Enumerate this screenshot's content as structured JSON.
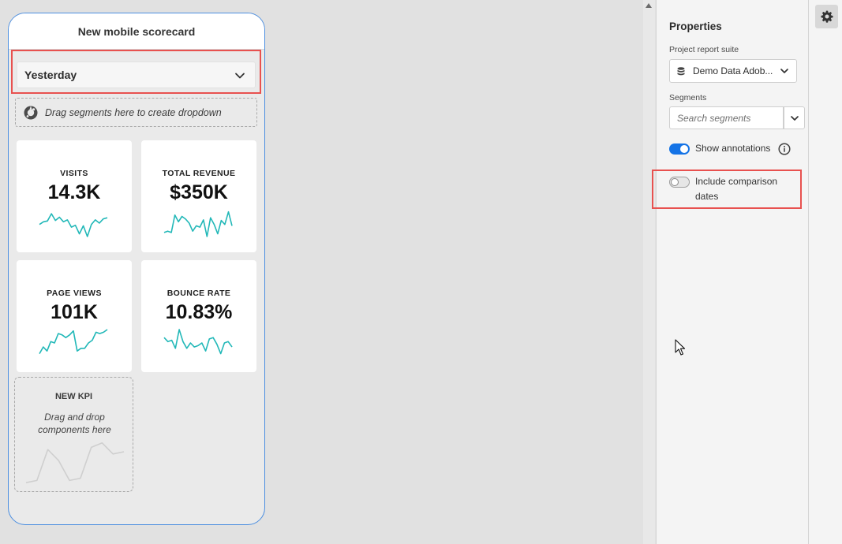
{
  "scorecard": {
    "title": "New mobile scorecard",
    "date_range": "Yesterday",
    "segment_drop_hint": "Drag segments here to create dropdown",
    "kpis": [
      {
        "title": "VISITS",
        "value": "14.3K",
        "trend": [
          0.45,
          0.55,
          0.58,
          0.85,
          0.6,
          0.72,
          0.55,
          0.62,
          0.35,
          0.42,
          0.1,
          0.4,
          0.0,
          0.45,
          0.62,
          0.5,
          0.66,
          0.7
        ],
        "accent": "#22b8b8"
      },
      {
        "title": "TOTAL REVENUE",
        "value": "$350K",
        "trend": [
          0.15,
          0.2,
          0.15,
          0.8,
          0.55,
          0.75,
          0.65,
          0.5,
          0.2,
          0.4,
          0.35,
          0.62,
          0.0,
          0.7,
          0.45,
          0.1,
          0.6,
          0.45,
          0.92,
          0.4
        ],
        "accent": "#22b8b8"
      },
      {
        "title": "PAGE VIEWS",
        "value": "101K",
        "trend": [
          0.1,
          0.35,
          0.2,
          0.55,
          0.5,
          0.85,
          0.8,
          0.7,
          0.8,
          0.95,
          0.2,
          0.3,
          0.3,
          0.5,
          0.6,
          0.9,
          0.85,
          0.9,
          1.0
        ],
        "accent": "#22b8b8"
      },
      {
        "title": "BOUNCE RATE",
        "value": "10.83%",
        "trend": [
          0.7,
          0.55,
          0.6,
          0.3,
          1.0,
          0.55,
          0.3,
          0.5,
          0.35,
          0.4,
          0.5,
          0.2,
          0.65,
          0.7,
          0.45,
          0.1,
          0.5,
          0.55,
          0.35
        ],
        "accent": "#22b8b8"
      }
    ],
    "new_kpi": {
      "title": "NEW KPI",
      "hint": "Drag and drop components here",
      "placeholder_trend": [
        0.05,
        0.1,
        0.8,
        0.55,
        0.1,
        0.15,
        0.85,
        0.95,
        0.7,
        0.75
      ]
    }
  },
  "properties": {
    "title": "Properties",
    "report_suite_label": "Project report suite",
    "report_suite_value": "Demo Data Adob...",
    "segments_label": "Segments",
    "segments_placeholder": "Search segments",
    "toggles": [
      {
        "label": "Show annotations",
        "on": true
      },
      {
        "label": "Include comparison dates",
        "on": false
      }
    ]
  },
  "colors": {
    "accent_blue": "#1473e6",
    "highlight_red": "#e8514f",
    "sparkline": "#22b8b8"
  },
  "icons": {
    "segment": "segment-icon",
    "database": "database-icon",
    "info": "info-icon",
    "settings": "gear-icon",
    "chevron": "chevron-down-icon"
  }
}
